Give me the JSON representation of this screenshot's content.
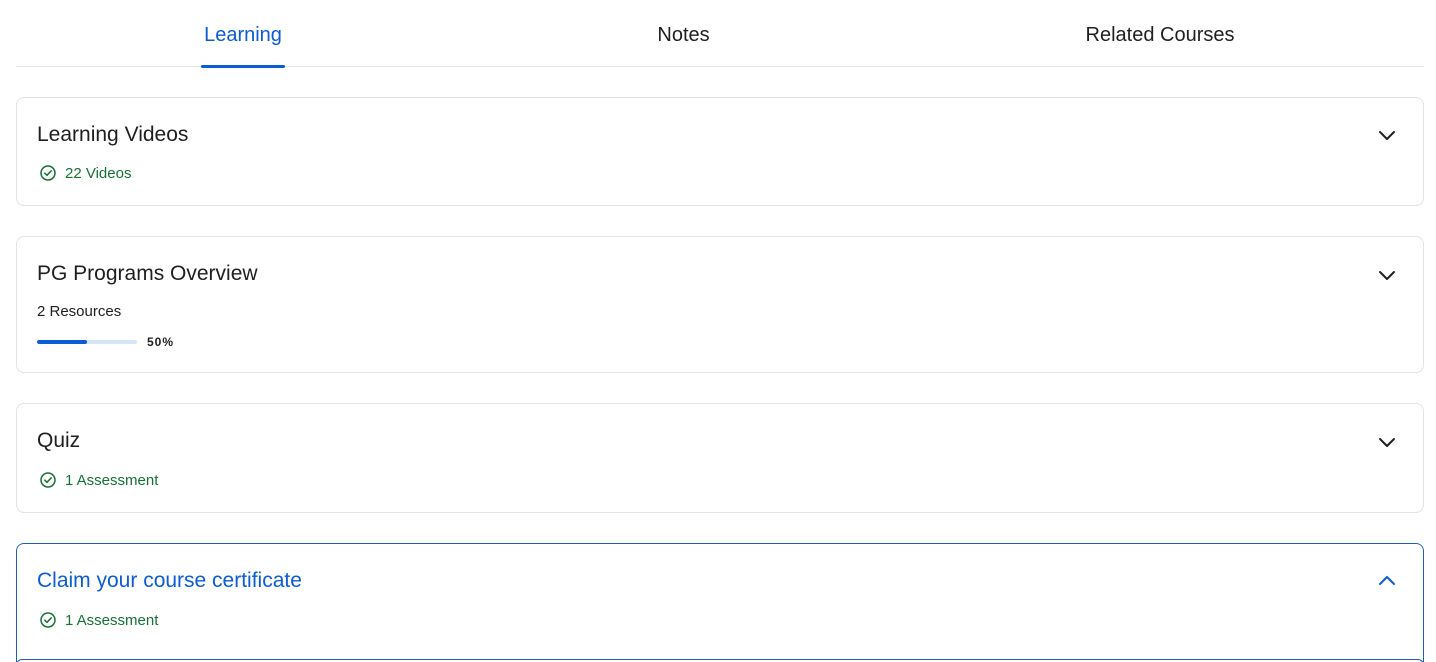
{
  "tabs": [
    {
      "label": "Learning",
      "active": true
    },
    {
      "label": "Notes",
      "active": false
    },
    {
      "label": "Related Courses",
      "active": false
    }
  ],
  "sections": [
    {
      "title": "Learning Videos",
      "meta": "22 Videos",
      "meta_icon": "check-circle-icon",
      "expanded": false
    },
    {
      "title": "PG Programs Overview",
      "meta": "2 Resources",
      "progress": {
        "value": 0.5,
        "label": "50%"
      },
      "expanded": false
    },
    {
      "title": "Quiz",
      "meta": "1 Assessment",
      "meta_icon": "check-circle-icon",
      "expanded": false
    },
    {
      "title": "Claim your course certificate",
      "meta": "1 Assessment",
      "meta_icon": "check-circle-icon",
      "expanded": true
    }
  ],
  "colors": {
    "accent": "#0b5cd5",
    "success": "#137333",
    "border": "#e3e3e3"
  }
}
